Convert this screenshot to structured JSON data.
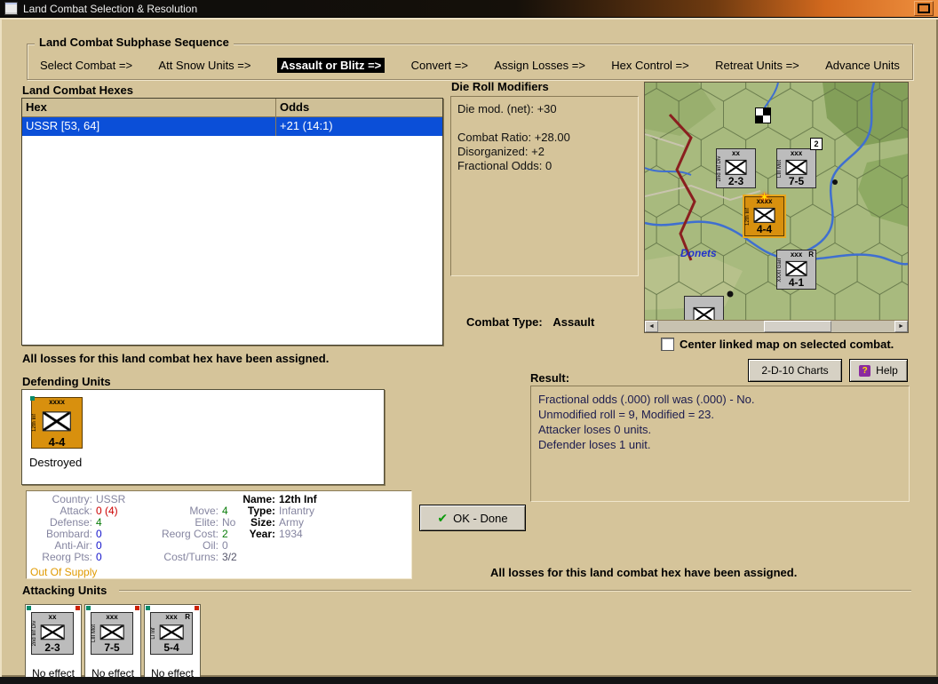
{
  "window": {
    "title": "Land Combat Selection & Resolution"
  },
  "colors": {
    "background_tan": "#d5c49a",
    "selection_blue": "#0b4fd8",
    "counter_orange": "#d8900e",
    "counter_gray": "#bcbcbc",
    "value_red": "#cc0000",
    "value_green": "#0a7d0a",
    "value_blue": "#1414cc",
    "supply_orange": "#e09a00",
    "titlebar_orange": "#e8852c"
  },
  "sequence": {
    "title": "Land Combat Subphase Sequence",
    "steps": [
      {
        "label": "Select Combat =>"
      },
      {
        "label": "Att Snow Units =>"
      },
      {
        "label": "Assault or Blitz =>",
        "active": true
      },
      {
        "label": "Convert =>"
      },
      {
        "label": "Assign Losses =>"
      },
      {
        "label": "Hex Control =>"
      },
      {
        "label": "Retreat Units =>"
      },
      {
        "label": "Advance Units"
      }
    ]
  },
  "combat_hexes": {
    "title": "Land Combat Hexes",
    "columns": {
      "hex": "Hex",
      "odds": "Odds"
    },
    "rows": [
      {
        "hex": "USSR [53, 64]",
        "odds": "+21 (14:1)",
        "selected": true
      }
    ]
  },
  "die_roll_modifiers": {
    "title": "Die Roll Modifiers",
    "lines": [
      "Die mod. (net): +30",
      "Combat Ratio: +28.00",
      "Disorganized: +2",
      "Fractional Odds: 0"
    ]
  },
  "combat_type": {
    "label": "Combat Type:",
    "value": "Assault"
  },
  "map": {
    "river_label": "Donets",
    "checkbox_label": "Center linked map on selected combat.",
    "checkbox_checked": false,
    "stack_badge": "2",
    "units": [
      {
        "strength": "2-3",
        "size": "xx",
        "side": "2nd Inf Div"
      },
      {
        "strength": "7-5",
        "size": "xxx",
        "side": "LIII Mot"
      },
      {
        "strength": "4-4",
        "size": "xxxx",
        "side": "12th Inf",
        "exploding": true
      },
      {
        "strength": "4-1",
        "size": "xxx",
        "side": "XXXI Garr",
        "r": "R"
      }
    ]
  },
  "buttons": {
    "charts": "2-D-10 Charts",
    "help": "Help",
    "ok": "OK - Done"
  },
  "messages": {
    "losses_left": "All losses for this land combat hex have been assigned.",
    "losses_right": "All losses for this land combat hex have been assigned."
  },
  "defending": {
    "title": "Defending Units",
    "unit": {
      "strength": "4-4",
      "size": "xxxx",
      "side": "12th Inf",
      "status": "Destroyed"
    }
  },
  "unit_details": {
    "col1": [
      {
        "label": "Country:",
        "value": "USSR"
      },
      {
        "label": "Attack:",
        "value": "0 (4)"
      },
      {
        "label": "Defense:",
        "value": "4"
      },
      {
        "label": "Bombard:",
        "value": "0"
      },
      {
        "label": "Anti-Air:",
        "value": "0"
      },
      {
        "label": "Reorg Pts:",
        "value": "0"
      }
    ],
    "col2": [
      {
        "label": "Move:",
        "value": "4"
      },
      {
        "label": "Elite:",
        "value": "No"
      },
      {
        "label": "Reorg Cost:",
        "value": "2"
      },
      {
        "label": "Oil:",
        "value": "0"
      },
      {
        "label": "Cost/Turns:",
        "value": "3/2"
      }
    ],
    "col3": [
      {
        "label": "Name:",
        "value": "12th Inf"
      },
      {
        "label": "Type:",
        "value": "Infantry"
      },
      {
        "label": "Size:",
        "value": "Army"
      },
      {
        "label": "Year:",
        "value": "1934"
      }
    ],
    "supply_status": "Out Of Supply"
  },
  "result": {
    "title": "Result:",
    "lines": [
      "Fractional odds (.000) roll was (.000) - No.",
      "Unmodified roll = 9, Modified = 23.",
      "Attacker loses 0 units.",
      "Defender loses 1 unit."
    ]
  },
  "attacking": {
    "title": "Attacking Units",
    "units": [
      {
        "strength": "2-3",
        "size": "xx",
        "side": "2nd Inf Div",
        "status": "No effect"
      },
      {
        "strength": "7-5",
        "size": "xxx",
        "side": "LIII Mot",
        "status": "No effect"
      },
      {
        "strength": "5-4",
        "size": "xxx",
        "side": "LI Inf",
        "status": "No effect",
        "r": "R"
      }
    ]
  }
}
